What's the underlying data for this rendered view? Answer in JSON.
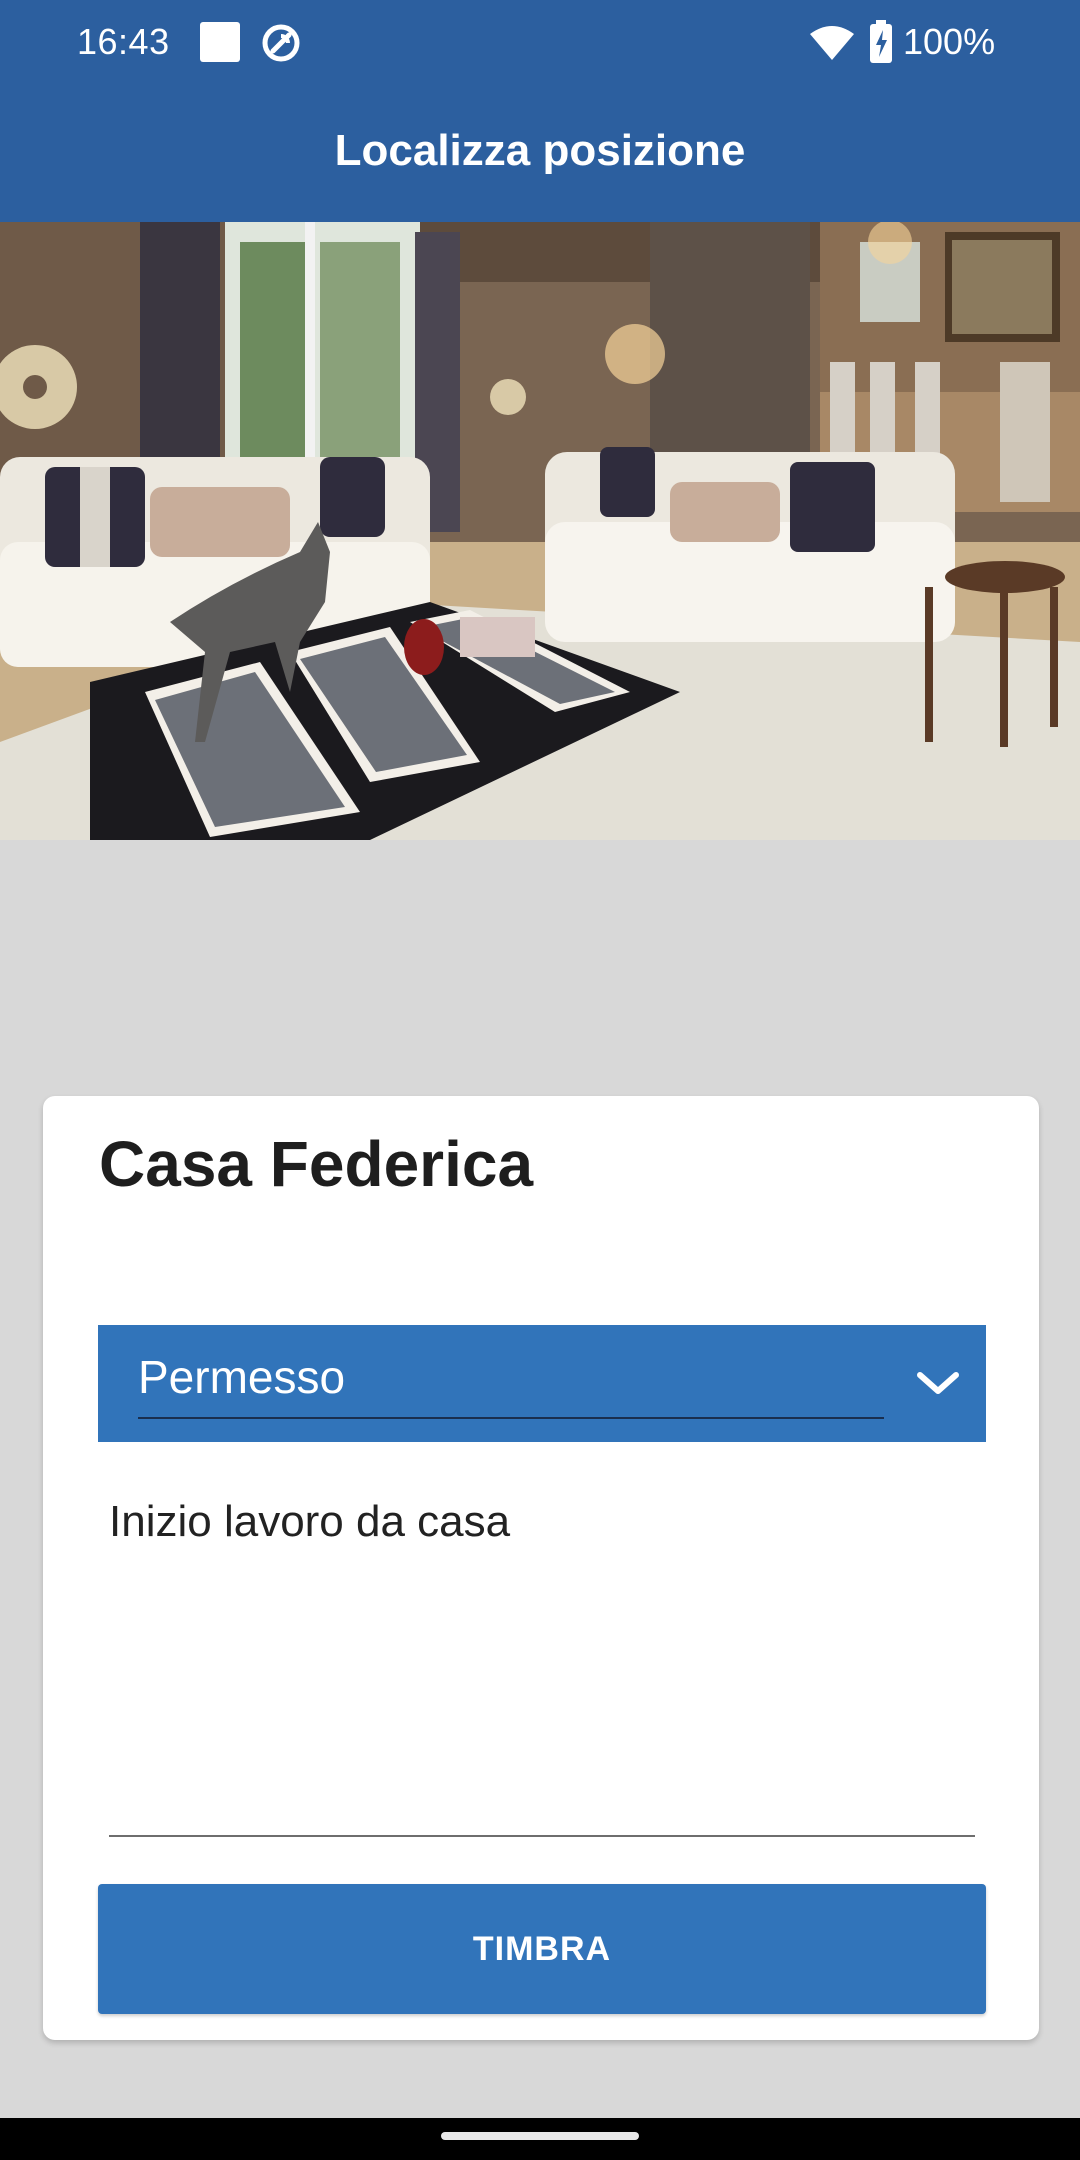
{
  "status_bar": {
    "time": "16:43",
    "battery": "100%",
    "icons": [
      "square-notification-icon",
      "circle-slash-icon",
      "wifi-icon",
      "battery-charging-icon"
    ]
  },
  "app_bar": {
    "title": "Localizza posizione"
  },
  "hero_image": {
    "description_icon": "living-room-photo"
  },
  "card": {
    "title": "Casa Federica",
    "dropdown": {
      "selected": "Permesso",
      "icon": "chevron-down-icon"
    },
    "note": {
      "value": "Inizio lavoro da casa"
    },
    "button_label": "TIMBRA"
  },
  "colors": {
    "primary_dark": "#2c5f9f",
    "primary": "#3174ba",
    "background": "#d8d8d8"
  }
}
